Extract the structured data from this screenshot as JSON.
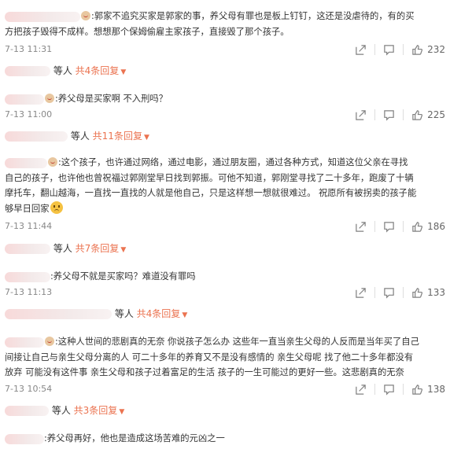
{
  "comments": [
    {
      "line1": ":郭家不追究买家是郭家的事，养父母有罪也是板上钉钉，这还是没虐待的，有的买",
      "line2": "方把孩子毁得不成样。想想那个保姆偷雇主家孩子，直接毁了那个孩子。",
      "time": "7-13 11:31",
      "likes": "232",
      "reply_prefix": "等人",
      "reply_count": "共4条回复"
    },
    {
      "line1": ":养父母是买家啊 不入刑吗？",
      "time": "7-13 11:00",
      "likes": "225",
      "reply_prefix": "等人",
      "reply_count": "共11条回复"
    },
    {
      "line1": ":这个孩子，也许通过网络，通过电影，通过朋友圈，通过各种方式，知道这位父亲在寻找",
      "line2": "自己的孩子，也许他也曾祝福过郭刚堂早日找到郭振。可他不知道，郭刚堂寻找了二十多年，跑废了十辆",
      "line3": "摩托车，翻山越海，一直找一直找的人就是他自己，只是这样想一想就很难过。 祝愿所有被拐卖的孩子能",
      "line4": "够早日回家",
      "time": "7-13 11:44",
      "likes": "186",
      "reply_prefix": "等人",
      "reply_count": "共7条回复"
    },
    {
      "line1": ":养父母不就是买家吗？难道没有罪吗",
      "time": "7-13 11:13",
      "likes": "133",
      "reply_prefix": "等人",
      "reply_count": "共4条回复"
    },
    {
      "line1": ":这种人世间的悲剧真的无奈 你说孩子怎么办 这些年一直当亲生父母的人反而是当年买了自己",
      "line2": "间接让自己与亲生父母分离的人 可二十多年的养育又不是没有感情的 亲生父母呢 找了他二十多年都没有",
      "line3": "放弃 可能没有这件事 亲生父母和孩子过着富足的生活 孩子的一生可能过的更好一些。这悲剧真的无奈",
      "time": "7-13 10:54",
      "likes": "138",
      "reply_prefix": "等人",
      "reply_count": "共3条回复"
    },
    {
      "line1": ":养父母再好，他也是造成这场苦难的元凶之一"
    }
  ],
  "icons": {
    "share": "share-icon",
    "comment": "comment-icon",
    "like": "like-icon",
    "emoji": "sad-face-emoji",
    "caret": "caret-down-icon"
  },
  "colors": {
    "link": "#eb7350",
    "text": "#333333",
    "meta": "#888888"
  }
}
